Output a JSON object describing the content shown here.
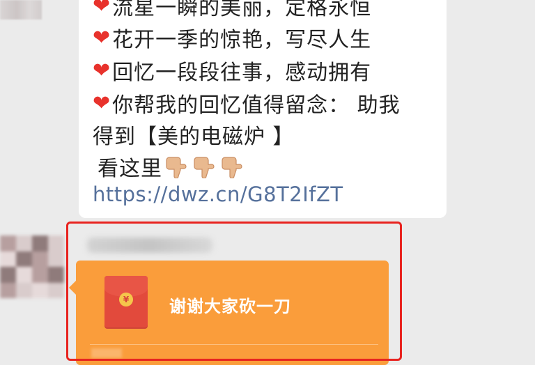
{
  "chat": {
    "message_lines": [
      "流星一瞬的美丽，定格永恒",
      "花开一季的惊艳，写尽人生",
      "回忆一段段往事，感动拥有",
      "你帮我的回忆值得留念：  助我",
      "得到【美的电磁炉 】",
      "看这里"
    ],
    "link": "https://dwz.cn/G8T2IfZT",
    "heart_icon": "❤️",
    "pointing_icon": "pointing-down-hand"
  },
  "red_packet": {
    "title": "谢谢大家砍一刀",
    "coin_symbol": "¥",
    "background_color": "#fa9d3b",
    "envelope_color": "#e24a3c"
  },
  "highlight_color": "#e8231f"
}
